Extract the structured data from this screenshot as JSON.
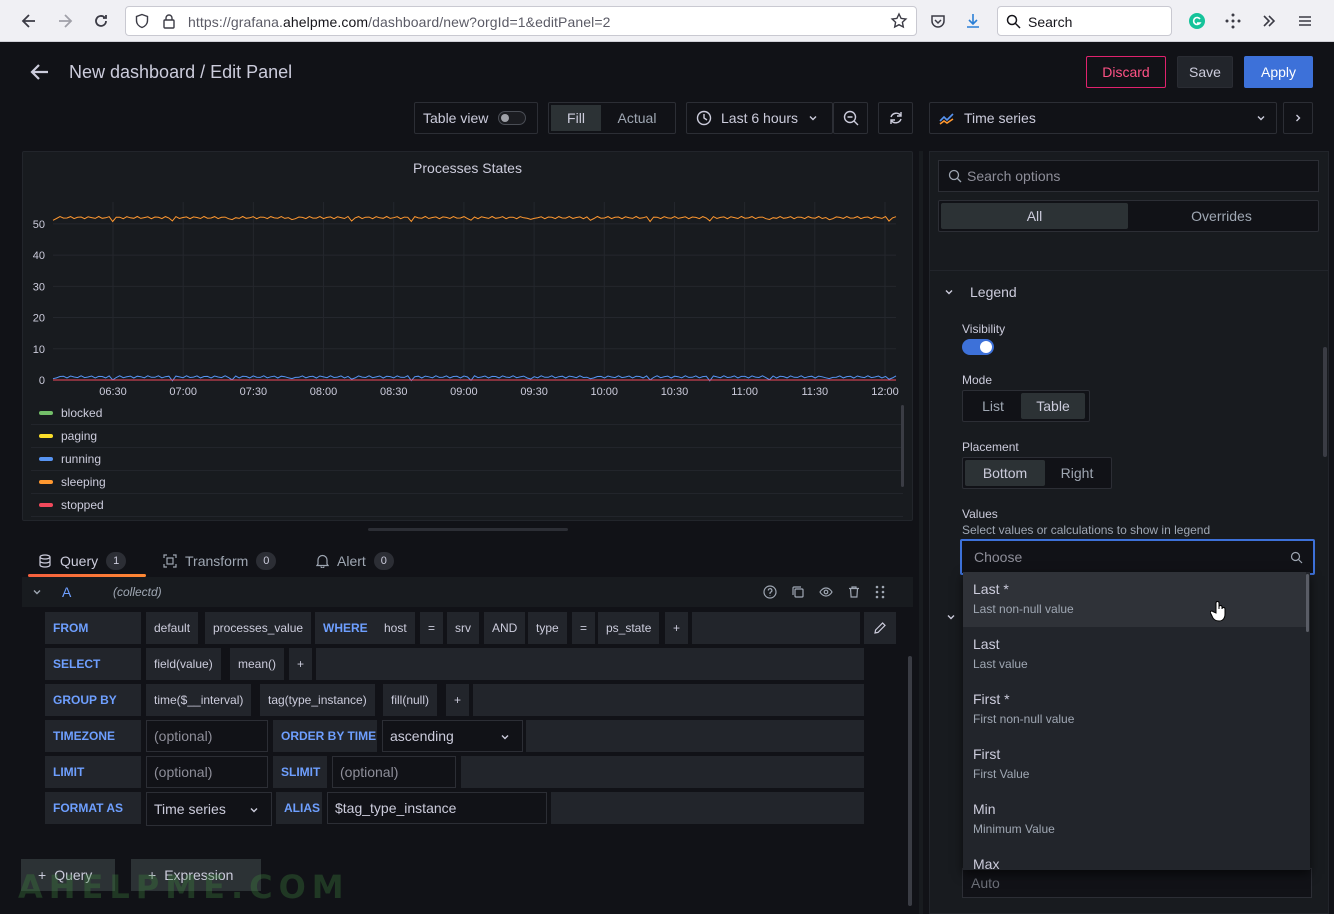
{
  "browser": {
    "url_prefix": "https://grafana.",
    "url_domain": "ahelpme.com",
    "url_path": "/dashboard/new?orgId=1&editPanel=2",
    "search_label": "Search"
  },
  "header": {
    "title": "New dashboard / Edit Panel",
    "discard_label": "Discard",
    "save_label": "Save",
    "apply_label": "Apply"
  },
  "toolbar": {
    "table_view_label": "Table view",
    "fill_label": "Fill",
    "actual_label": "Actual",
    "time_range_label": "Last 6 hours",
    "visualization_label": "Time series"
  },
  "panel": {
    "title": "Processes States"
  },
  "chart_data": {
    "type": "line",
    "title": "Processes States",
    "x": [
      "06:30",
      "07:00",
      "07:30",
      "08:00",
      "08:30",
      "09:00",
      "09:30",
      "10:00",
      "10:30",
      "11:00",
      "11:30",
      "12:00"
    ],
    "y_ticks": [
      "0",
      "10",
      "20",
      "30",
      "40",
      "50"
    ],
    "ylim": [
      0,
      57
    ],
    "series": [
      {
        "name": "blocked",
        "color": "#73bf69",
        "values": [
          0,
          0,
          0,
          0,
          0,
          0,
          0,
          0,
          0,
          0,
          0,
          0
        ]
      },
      {
        "name": "paging",
        "color": "#fade2a",
        "values": [
          0,
          0,
          0,
          0,
          0,
          0,
          0,
          0,
          0,
          0,
          0,
          0
        ]
      },
      {
        "name": "running",
        "color": "#5794f2",
        "values": [
          1,
          1,
          1,
          1,
          1,
          1,
          1,
          1,
          1,
          1,
          1,
          1
        ]
      },
      {
        "name": "sleeping",
        "color": "#ff9830",
        "values": [
          52,
          52,
          52,
          52,
          52,
          52,
          52,
          52,
          52,
          52,
          52,
          52
        ]
      },
      {
        "name": "stopped",
        "color": "#f2495c",
        "values": [
          0,
          0,
          0,
          0,
          0,
          0,
          0,
          0,
          0,
          0,
          0,
          0
        ]
      }
    ],
    "legend": "bottom"
  },
  "tabs": {
    "query_label": "Query",
    "query_count": "1",
    "transform_label": "Transform",
    "transform_count": "0",
    "alert_label": "Alert",
    "alert_count": "0"
  },
  "query": {
    "ref_id": "A",
    "datasource": "(collectd)",
    "from_kw": "FROM",
    "from_policy": "default",
    "from_measurement": "processes_value",
    "where_kw": "WHERE",
    "where_key1": "host",
    "where_op1": "=",
    "where_val1": "srv",
    "where_and": "AND",
    "where_key2": "type",
    "where_op2": "=",
    "where_val2": "ps_state",
    "plus": "+",
    "select_kw": "SELECT",
    "select_field": "field(value)",
    "select_fn": "mean()",
    "groupby_kw": "GROUP BY",
    "groupby_time": "time($__interval)",
    "groupby_tag": "tag(type_instance)",
    "groupby_fill": "fill(null)",
    "timezone_kw": "TIMEZONE",
    "optional": "(optional)",
    "orderby_kw": "ORDER BY TIME",
    "orderby_value": "ascending",
    "limit_kw": "LIMIT",
    "slimit_kw": "SLIMIT",
    "format_kw": "FORMAT AS",
    "format_value": "Time series",
    "alias_kw": "ALIAS",
    "alias_value": "$tag_type_instance",
    "add_query_label": "Query",
    "add_expression_label": "Expression"
  },
  "watermark": "AHELPME.COM",
  "options": {
    "search_placeholder": "Search options",
    "all_label": "All",
    "overrides_label": "Overrides",
    "legend_section": "Legend",
    "visibility_label": "Visibility",
    "mode_label": "Mode",
    "mode_list": "List",
    "mode_table": "Table",
    "placement_label": "Placement",
    "placement_bottom": "Bottom",
    "placement_right": "Right",
    "values_label": "Values",
    "values_desc": "Select values or calculations to show in legend",
    "values_placeholder": "Choose",
    "auto_placeholder": "Auto"
  },
  "dropdown": [
    {
      "label": "Last *",
      "desc": "Last non-null value"
    },
    {
      "label": "Last",
      "desc": "Last value"
    },
    {
      "label": "First *",
      "desc": "First non-null value"
    },
    {
      "label": "First",
      "desc": "First Value"
    },
    {
      "label": "Min",
      "desc": "Minimum Value"
    },
    {
      "label": "Max",
      "desc": ""
    }
  ]
}
